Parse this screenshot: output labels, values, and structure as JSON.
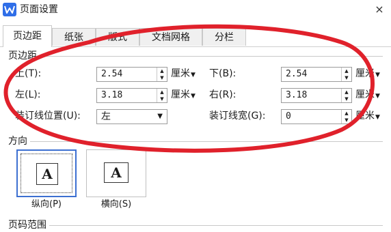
{
  "window": {
    "title": "页面设置",
    "close_label": "×"
  },
  "tabs": [
    {
      "label": "页边距",
      "active": true
    },
    {
      "label": "纸张",
      "active": false
    },
    {
      "label": "版式",
      "active": false
    },
    {
      "label": "文档网格",
      "active": false
    },
    {
      "label": "分栏",
      "active": false
    }
  ],
  "margins": {
    "group_label": "页边距",
    "top": {
      "label": "上(T):",
      "value": "2.54",
      "unit": "厘米"
    },
    "bottom": {
      "label": "下(B):",
      "value": "2.54",
      "unit": "厘米"
    },
    "left": {
      "label": "左(L):",
      "value": "3.18",
      "unit": "厘米"
    },
    "right": {
      "label": "右(R):",
      "value": "3.18",
      "unit": "厘米"
    },
    "gutter_position": {
      "label": "装订线位置(U):",
      "value": "左"
    },
    "gutter_width": {
      "label": "装订线宽(G):",
      "value": "0",
      "unit": "厘米"
    }
  },
  "orientation": {
    "group_label": "方向",
    "portrait": {
      "label": "纵向(P)",
      "glyph": "A",
      "selected": true
    },
    "landscape": {
      "label": "横向(S)",
      "glyph": "A",
      "selected": false
    }
  },
  "page_range": {
    "group_label": "页码范围"
  },
  "colors": {
    "accent": "#3c6fd1",
    "annotation": "#e0212b",
    "app_icon": "#2f6ee8"
  },
  "icons": {
    "app": "wps-writer-icon",
    "close": "close-icon",
    "spin_up": "spin-up-icon",
    "spin_down": "spin-down-icon",
    "dropdown": "chevron-down-icon"
  }
}
